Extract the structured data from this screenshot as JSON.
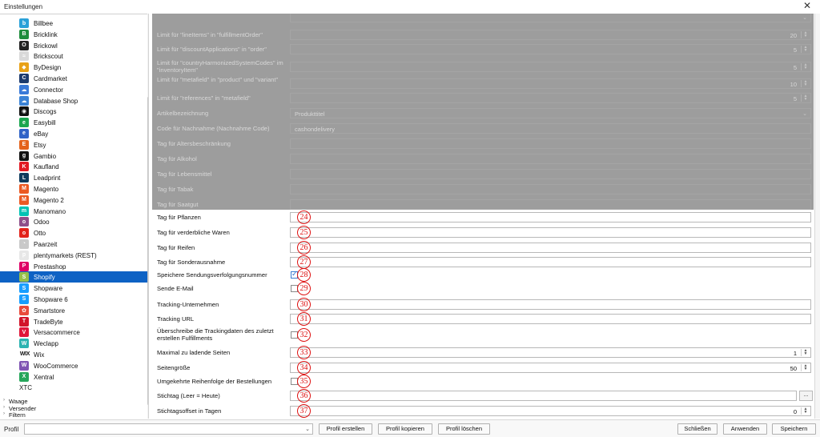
{
  "window": {
    "title": "Einstellungen",
    "close_glyph": "✕"
  },
  "sidebar": {
    "items": [
      {
        "label": "Billbee",
        "icon": "billbee-icon",
        "color": "#2aa1d8",
        "glyph": "b"
      },
      {
        "label": "Bricklink",
        "icon": "bricklink-icon",
        "color": "#1f8d3d",
        "glyph": "B"
      },
      {
        "label": "Brickowl",
        "icon": "brickowl-icon",
        "color": "#222222",
        "glyph": "O"
      },
      {
        "label": "Brickscout",
        "icon": "brickscout-icon",
        "color": "#d9d9d9",
        "glyph": "≈"
      },
      {
        "label": "ByDesign",
        "icon": "bydesign-icon",
        "color": "#e8a116",
        "glyph": "◆"
      },
      {
        "label": "Cardmarket",
        "icon": "cardmarket-icon",
        "color": "#1d3b6e",
        "glyph": "C"
      },
      {
        "label": "Connector",
        "icon": "connector-icon",
        "color": "#3a7ad8",
        "glyph": "☁"
      },
      {
        "label": "Database Shop",
        "icon": "database-shop-icon",
        "color": "#3c83d6",
        "glyph": "☁"
      },
      {
        "label": "Discogs",
        "icon": "discogs-icon",
        "color": "#111111",
        "glyph": "◉"
      },
      {
        "label": "Easybill",
        "icon": "easybill-icon",
        "color": "#1aa64f",
        "glyph": "e"
      },
      {
        "label": "eBay",
        "icon": "ebay-icon",
        "color": "#2f63c7",
        "glyph": "e"
      },
      {
        "label": "Etsy",
        "icon": "etsy-icon",
        "color": "#e4631c",
        "glyph": "E"
      },
      {
        "label": "Gambio",
        "icon": "gambio-icon",
        "color": "#111111",
        "glyph": "g"
      },
      {
        "label": "Kaufland",
        "icon": "kaufland-icon",
        "color": "#e21a23",
        "glyph": "K"
      },
      {
        "label": "Leadprint",
        "icon": "leadprint-icon",
        "color": "#0e3a5c",
        "glyph": "L"
      },
      {
        "label": "Magento",
        "icon": "magento-icon",
        "color": "#eb5a23",
        "glyph": "M"
      },
      {
        "label": "Magento 2",
        "icon": "magento-2-icon",
        "color": "#eb5a23",
        "glyph": "M"
      },
      {
        "label": "Manomano",
        "icon": "manomano-icon",
        "color": "#00c3b4",
        "glyph": "m"
      },
      {
        "label": "Odoo",
        "icon": "odoo-icon",
        "color": "#8e4f8a",
        "glyph": "o"
      },
      {
        "label": "Otto",
        "icon": "otto-icon",
        "color": "#e2231a",
        "glyph": "o"
      },
      {
        "label": "Paarzeit",
        "icon": "paarzeit-icon",
        "color": "#c9c9c9",
        "glyph": "◔"
      },
      {
        "label": "plentymarkets (REST)",
        "icon": "plentymarkets-icon",
        "color": "#e7e7e7",
        "glyph": "p"
      },
      {
        "label": "Prestashop",
        "icon": "prestashop-icon",
        "color": "#df0067",
        "glyph": "P"
      },
      {
        "label": "Shopify",
        "icon": "shopify-icon",
        "color": "#96bf48",
        "glyph": "S"
      },
      {
        "label": "Shopware",
        "icon": "shopware-icon",
        "color": "#189eff",
        "glyph": "S"
      },
      {
        "label": "Shopware 6",
        "icon": "shopware-6-icon",
        "color": "#189eff",
        "glyph": "S"
      },
      {
        "label": "Smartstore",
        "icon": "smartstore-icon",
        "color": "#e94b3c",
        "glyph": "✿"
      },
      {
        "label": "TradeByte",
        "icon": "tradebyte-icon",
        "color": "#d2142a",
        "glyph": "T"
      },
      {
        "label": "Versacommerce",
        "icon": "versacommerce-icon",
        "color": "#e0173b",
        "glyph": "V"
      },
      {
        "label": "Weclapp",
        "icon": "weclapp-icon",
        "color": "#2bb3b1",
        "glyph": "W"
      },
      {
        "label": "Wix",
        "icon": "wix-icon",
        "color": "#111111",
        "glyph": "WIX"
      },
      {
        "label": "WooCommerce",
        "icon": "woocommerce-icon",
        "color": "#7f54b3",
        "glyph": "W"
      },
      {
        "label": "Xentral",
        "icon": "xentral-icon",
        "color": "#26a65b",
        "glyph": "X"
      },
      {
        "label": "XTC",
        "icon": "",
        "color": "",
        "glyph": ""
      }
    ],
    "selected": "Shopify",
    "sections": [
      {
        "label": "Waage",
        "arrow": "›"
      },
      {
        "label": "Versender",
        "arrow": "›"
      },
      {
        "label": "Filtern",
        "arrow": "›"
      }
    ]
  },
  "form": {
    "rows": [
      {
        "label": "",
        "type": "combo",
        "value": "",
        "disabled": true
      },
      {
        "label": "Limit für \"lineItems\" in \"fulfillmentOrder\"",
        "type": "number",
        "value": "20",
        "disabled": true
      },
      {
        "label": "Limit für \"discountApplications\" in \"order\"",
        "type": "number",
        "value": "5",
        "disabled": true
      },
      {
        "label": "Limit für \"countryHarmonizedSystemCodes\" im \"inventoryItem\"",
        "type": "number",
        "value": "5",
        "disabled": true
      },
      {
        "label": "Limit für \"metafield\" in \"product\" und \"variant\"",
        "type": "number",
        "value": "10",
        "disabled": true
      },
      {
        "label": "Limit für \"references\" in \"metafield\"",
        "type": "number",
        "value": "5",
        "disabled": true
      },
      {
        "label": "Artikelbezeichnung",
        "type": "combo",
        "value": "Produkttitel",
        "disabled": true
      },
      {
        "label": "Code für Nachnahme (Nachnahme Code)",
        "type": "text",
        "value": "cashondelivery",
        "disabled": true
      },
      {
        "label": "Tag für Altersbeschränkung",
        "type": "text",
        "value": "",
        "disabled": true
      },
      {
        "label": "Tag für Alkohol",
        "type": "text",
        "value": "",
        "disabled": true
      },
      {
        "label": "Tag für Lebensmittel",
        "type": "text",
        "value": "",
        "disabled": true
      },
      {
        "label": "Tag für Tabak",
        "type": "text",
        "value": "",
        "disabled": true
      },
      {
        "label": "Tag für Saatgut",
        "type": "text",
        "value": "",
        "disabled": true
      },
      {
        "label": "Tag für Pflanzen",
        "type": "text",
        "value": "",
        "disabled": false,
        "marker": "24"
      },
      {
        "label": "Tag für verderbliche Waren",
        "type": "text",
        "value": "",
        "disabled": false,
        "marker": "25"
      },
      {
        "label": "Tag für Reifen",
        "type": "text",
        "value": "",
        "disabled": false,
        "marker": "26"
      },
      {
        "label": "Tag für Sonderausnahme",
        "type": "text",
        "value": "",
        "disabled": false,
        "marker": "27"
      },
      {
        "label": "Speichere Sendungsverfolgungsnummer",
        "type": "checkbox",
        "checked": true,
        "disabled": false,
        "marker": "28"
      },
      {
        "label": "Sende E-Mail",
        "type": "checkbox",
        "checked": false,
        "disabled": false,
        "marker": "29"
      },
      {
        "label": "Tracking-Unternehmen",
        "type": "text",
        "value": "",
        "disabled": false,
        "marker": "30"
      },
      {
        "label": "Tracking URL",
        "type": "text",
        "value": "",
        "disabled": false,
        "marker": "31"
      },
      {
        "label": "Überschreibe die Trackingdaten des zuletzt erstellen Fulfillments",
        "type": "checkbox",
        "checked": false,
        "disabled": false,
        "marker": "32"
      },
      {
        "label": "Maximal zu ladende Seiten",
        "type": "number",
        "value": "1",
        "disabled": false,
        "marker": "33"
      },
      {
        "label": "Seitengröße",
        "type": "number",
        "value": "50",
        "disabled": false,
        "marker": "34"
      },
      {
        "label": "Umgekehrte Reihenfolge der Bestellungen",
        "type": "checkbox",
        "checked": false,
        "disabled": false,
        "marker": "35"
      },
      {
        "label": "Stichtag (Leer = Heute)",
        "type": "date",
        "value": "",
        "browse": "...",
        "disabled": false,
        "marker": "36"
      },
      {
        "label": "Stichtagsoffset in Tagen",
        "type": "number",
        "value": "0",
        "disabled": false,
        "marker": "37"
      }
    ]
  },
  "bottom": {
    "profile_label": "Profil",
    "profile_value": "",
    "buttons": {
      "create": "Profil erstellen",
      "copy": "Profil kopieren",
      "delete": "Profil löschen",
      "close": "Schließen",
      "apply": "Anwenden",
      "save": "Speichern"
    }
  }
}
